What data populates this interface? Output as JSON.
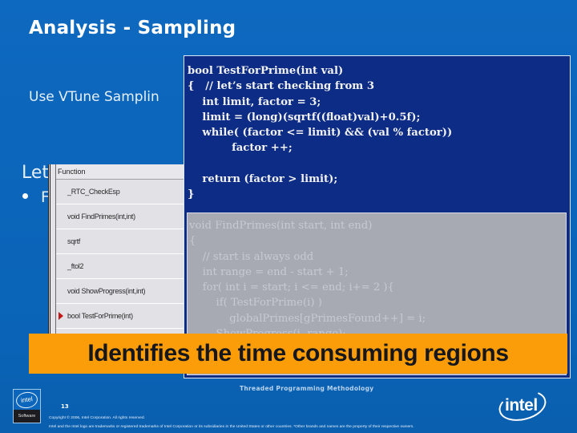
{
  "slide": {
    "title": "Analysis - Sampling",
    "body_line_1": "Use VTune Samplin",
    "body_line_2": "Let",
    "bullet_text": "F"
  },
  "vtune_window": {
    "column_header": "Function",
    "rows": [
      {
        "label": "_RTC_CheckEsp",
        "marked": false
      },
      {
        "label": "void FindPrimes(int,int)",
        "marked": false
      },
      {
        "label": "sqrtf",
        "marked": false
      },
      {
        "label": "_ftol2",
        "marked": false
      },
      {
        "label": "void ShowProgress(int,int)",
        "marked": false
      },
      {
        "label": "bool TestForPrime(int)",
        "marked": true
      }
    ],
    "marker_icon": "hotspot-arrow-icon",
    "marker_color": "#c01818"
  },
  "code_window": {
    "highlighted_lines": [
      "bool TestForPrime(int val)",
      "{   // let’s start checking from 3",
      "    int limit, factor = 3;",
      "    limit = (long)(sqrtf((float)val)+0.5f);",
      "    while( (factor <= limit) && (val % factor))",
      "            factor ++;",
      "",
      "    return (factor > limit);",
      "}"
    ],
    "dimmed_lines": [
      "void FindPrimes(int start, int end)",
      "{",
      "    // start is always odd",
      "    int range = end - start + 1;",
      "    for( int i = start; i <= end; i+= 2 ){",
      "        if( TestForPrime(i) )",
      "            globalPrimes[gPrimesFound++] = i;",
      "        ShowProgress(i, range);"
    ]
  },
  "callout": {
    "text": "Identifies the time consuming regions",
    "background_color": "#fb9c09"
  },
  "footer": {
    "course_title": "Threaded Programming Methodology",
    "page_number": "13",
    "badge_logo": "intel",
    "badge_label": "Software",
    "copyright": "Copyright © 2006, Intel Corporation. All rights reserved.",
    "trademark": "Intel and the Intel logo are trademarks or registered trademarks of Intel Corporation or its subsidiaries in the United States or other countries. *Other brands and names are the property of their respective owners.",
    "logo_text": "intel"
  },
  "colors": {
    "slide_background": "#0b64b8",
    "code_highlight_background": "#0d2c86",
    "code_dimmed_background": "#a7aab3"
  }
}
